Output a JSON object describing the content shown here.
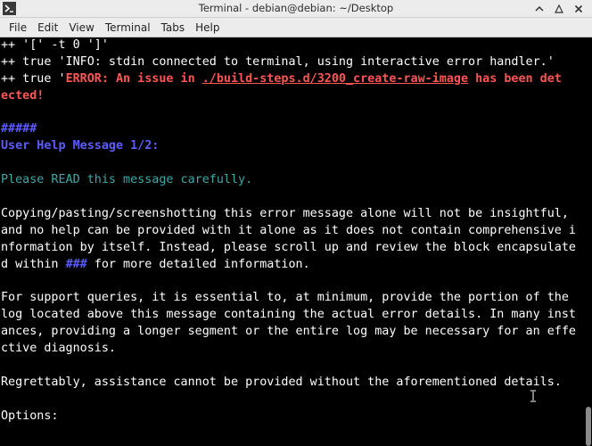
{
  "window": {
    "title": "Terminal - debian@debian: ~/Desktop",
    "icons": {
      "app": "terminal-icon",
      "minimize": "chevron-up-icon",
      "maximize": "maximize-icon",
      "close": "close-icon"
    }
  },
  "menubar": {
    "items": [
      "File",
      "Edit",
      "View",
      "Terminal",
      "Tabs",
      "Help"
    ]
  },
  "terminal": {
    "colors": {
      "background": "#000000",
      "text": "#ffffff",
      "error": "#ff5555",
      "heading": "#5c5cff",
      "notice": "#3fa8a8"
    },
    "l1": "++ '[' -t 0 ']'",
    "l2": "++ true 'INFO: stdin connected to terminal, using interactive error handler.'",
    "l3a": "++ true '",
    "l3b": "ERROR: An issue in ",
    "l3c": "./build-steps.d/3200_create-raw-image",
    "l3d": " has been det",
    "l4": "ected!",
    "l6": "#####",
    "l7": "User Help Message 1/2:",
    "l9": "Please READ this message carefully.",
    "l11": "Copying/pasting/screenshotting this error message alone will not be insightful,",
    "l12": "and no help can be provided with it alone as it does not contain comprehensive i",
    "l13": "nformation by itself. Instead, please scroll up and review the block encapsulate",
    "l14a": "d within ",
    "l14b": "###",
    "l14c": " for more detailed information.",
    "l16": "For support queries, it is essential to, at minimum, provide the portion of the",
    "l17": "log located above this message containing the actual error details. In many inst",
    "l18": "ances, providing a longer segment or the entire log may be necessary for an effe",
    "l19": "ctive diagnosis.",
    "l21": "Regrettably, assistance cannot be provided without the aforementioned details.",
    "l23": "Options:"
  }
}
